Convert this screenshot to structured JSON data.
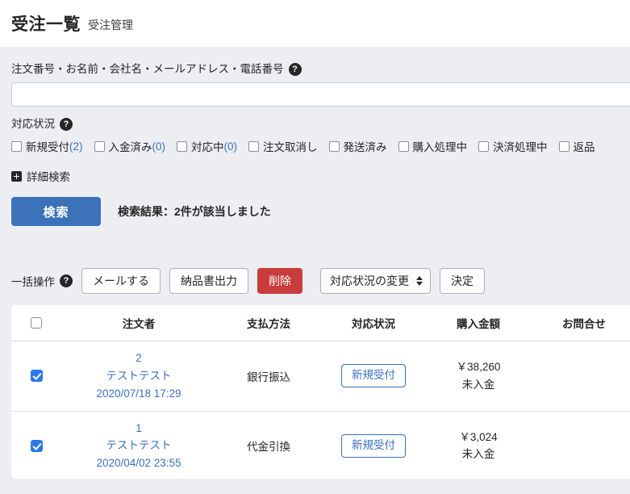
{
  "header": {
    "title": "受注一覧",
    "subtitle": "受注管理"
  },
  "search": {
    "keyword_label": "注文番号・お名前・会社名・メールアドレス・電話番号",
    "keyword_help_icon": "help-circle-icon",
    "keyword_value": "",
    "keyword_placeholder": "",
    "status_label": "対応状況",
    "status_help_icon": "help-circle-icon",
    "status_checkboxes": [
      {
        "label": "新規受付",
        "count": "(2)"
      },
      {
        "label": "入金済み",
        "count": "(0)"
      },
      {
        "label": "対応中",
        "count": "(0)"
      },
      {
        "label": "注文取消し",
        "count": ""
      },
      {
        "label": "発送済み",
        "count": ""
      },
      {
        "label": "購入処理中",
        "count": ""
      },
      {
        "label": "決済処理中",
        "count": ""
      },
      {
        "label": "返品",
        "count": ""
      }
    ],
    "detail_toggle_label": "詳細検索",
    "detail_toggle_icon": "plus-square-icon",
    "search_button_label": "検索",
    "result_text": "検索結果：2件が該当しました"
  },
  "bulk": {
    "label": "一括操作",
    "help_icon": "help-circle-icon",
    "mail_button_label": "メールする",
    "invoice_button_label": "納品書出力",
    "delete_button_label": "削除",
    "status_select_value": "対応状況の変更",
    "status_select_icon": "updown-arrows-icon",
    "confirm_button_label": "決定"
  },
  "table": {
    "columns": [
      "",
      "注文者",
      "支払方法",
      "対応状況",
      "購入金額",
      "お問合せ"
    ],
    "rows": [
      {
        "checked": true,
        "order_no": "2",
        "customer_name": "テストテスト",
        "order_date": "2020/07/18 17:29",
        "payment_method": "銀行振込",
        "status": "新規受付",
        "amount": "￥38,260",
        "payment_state": "未入金",
        "inquiry": ""
      },
      {
        "checked": true,
        "order_no": "1",
        "customer_name": "テストテスト",
        "order_date": "2020/04/02 23:55",
        "payment_method": "代金引換",
        "status": "新規受付",
        "amount": "￥3,024",
        "payment_state": "未入金",
        "inquiry": ""
      }
    ]
  },
  "colors": {
    "accent_blue": "#3c72b9",
    "link_blue": "#3c6fbb",
    "danger_red": "#c83c3c",
    "panel_gray": "#eceef2",
    "checkbox_blue": "#2979e8"
  }
}
